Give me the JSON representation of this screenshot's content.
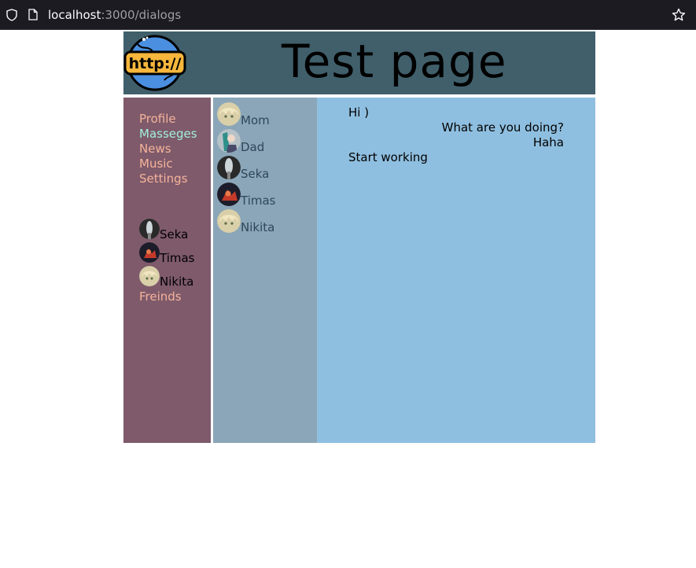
{
  "browser": {
    "url_host": "localhost",
    "url_rest": ":3000/dialogs",
    "icons": [
      "shield-icon",
      "page-icon",
      "star-icon"
    ]
  },
  "header": {
    "title": "Test page",
    "logo_text": "http://"
  },
  "nav": {
    "items": [
      {
        "label": "Profile",
        "active": false
      },
      {
        "label": "Masseges",
        "active": true
      },
      {
        "label": "News",
        "active": false
      },
      {
        "label": "Music",
        "active": false
      },
      {
        "label": "Settings",
        "active": false
      }
    ],
    "friends": [
      {
        "name": "Seka",
        "avatar": "avatar-dark-icon"
      },
      {
        "name": "Timas",
        "avatar": "avatar-red-icon"
      },
      {
        "name": "Nikita",
        "avatar": "avatar-blonde-icon"
      }
    ],
    "friends_link": "Freinds"
  },
  "dialogs": {
    "items": [
      {
        "name": "Mom",
        "avatar": "avatar-blonde-icon"
      },
      {
        "name": "Dad",
        "avatar": "avatar-teal-icon"
      },
      {
        "name": "Seka",
        "avatar": "avatar-dark-icon"
      },
      {
        "name": "Timas",
        "avatar": "avatar-red-icon"
      },
      {
        "name": "Nikita",
        "avatar": "avatar-blonde-icon"
      }
    ]
  },
  "messages": [
    {
      "text": "Hi )",
      "side": "left"
    },
    {
      "text": "What are you doing?",
      "side": "right"
    },
    {
      "text": "Haha",
      "side": "right"
    },
    {
      "text": "Start working",
      "side": "left"
    }
  ],
  "colors": {
    "header_bg": "#405f6b",
    "nav_bg": "#7e5a6b",
    "nav_link": "#f5b39a",
    "nav_active": "#9ff0dc",
    "dialogs_bg": "#8ba6b8",
    "messages_bg": "#8fbfe0"
  }
}
